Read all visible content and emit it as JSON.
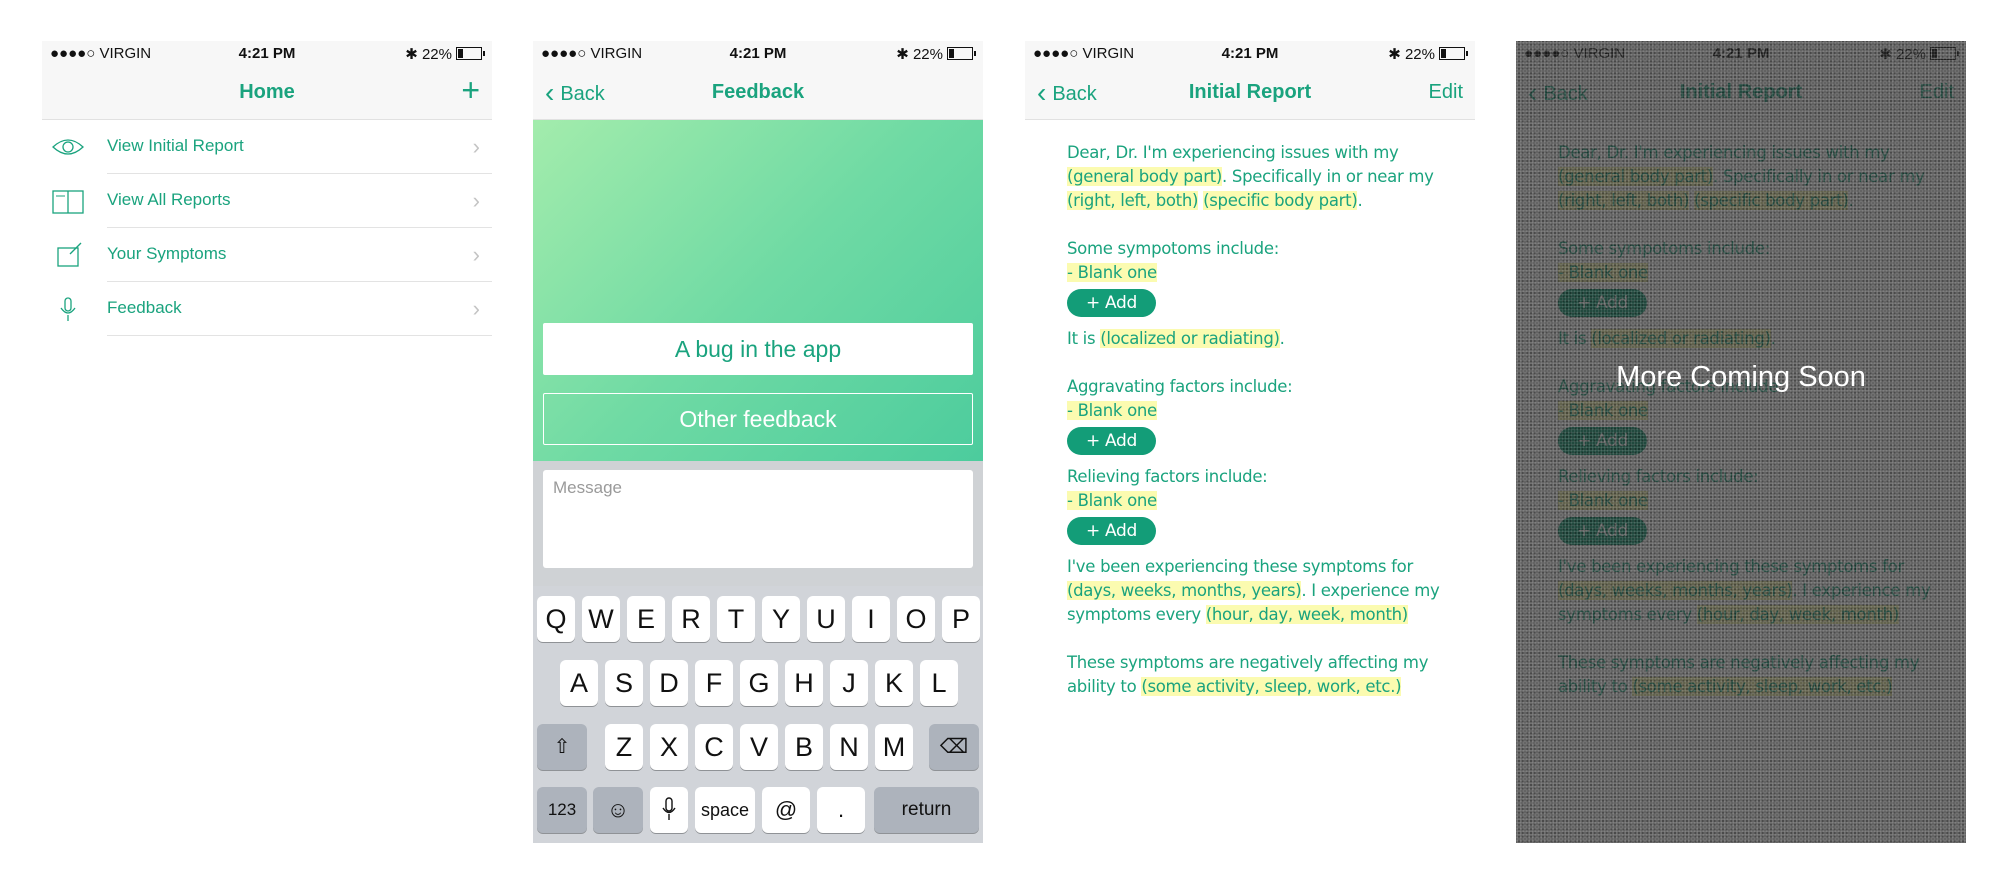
{
  "status": {
    "carrier": "●●●●○ VIRGIN",
    "time": "4:21 PM",
    "battery": "22%"
  },
  "home": {
    "title": "Home",
    "add_icon": "plus-icon",
    "items": [
      {
        "label": "View Initial Report",
        "icon": "eye-icon"
      },
      {
        "label": "View All Reports",
        "icon": "book-icon"
      },
      {
        "label": "Your Symptoms",
        "icon": "edit-icon"
      },
      {
        "label": "Feedback",
        "icon": "microphone-icon"
      }
    ]
  },
  "feedback": {
    "back": "Back",
    "title": "Feedback",
    "bug_button": "A bug in the app",
    "other_button": "Other feedback",
    "message_placeholder": "Message",
    "keyboard": {
      "row1": [
        "Q",
        "W",
        "E",
        "R",
        "T",
        "Y",
        "U",
        "I",
        "O",
        "P"
      ],
      "row2": [
        "A",
        "S",
        "D",
        "F",
        "G",
        "H",
        "J",
        "K",
        "L"
      ],
      "row3": [
        "Z",
        "X",
        "C",
        "V",
        "B",
        "N",
        "M"
      ],
      "numbers": "123",
      "space": "space",
      "at": "@",
      "period": ".",
      "return": "return"
    }
  },
  "report": {
    "back": "Back",
    "title": "Initial Report",
    "edit": "Edit",
    "intro_1": "Dear, Dr. I'm experiencing issues with my ",
    "general_part": "(general body part)",
    "intro_2": ". Specifically in or near my ",
    "side": "(right, left, both)",
    "specific_part": "(specific body part)",
    "period": ".",
    "symptoms_label": "Some sympotoms include:",
    "blank_one": "- Blank one",
    "add_label": "+ Add",
    "it_is": "It is ",
    "localized": "(localized or radiating)",
    "aggravating_label": "Aggravating factors include:",
    "relieving_label": "Relieving factors include:",
    "duration_1": "I've been experiencing these symptoms for ",
    "duration_units": "(days, weeks, months, years)",
    "duration_2": ". I experience my symptoms every ",
    "frequency": "(hour, day, week, month)",
    "affecting_1": "These symptoms are negatively affecting my ability to ",
    "activity": "(some activity, sleep, work, etc.)"
  },
  "overlay": {
    "text": "More Coming Soon"
  },
  "colors": {
    "accent": "#1aa37e",
    "highlight": "#fbfbb0",
    "button": "#139d78"
  }
}
